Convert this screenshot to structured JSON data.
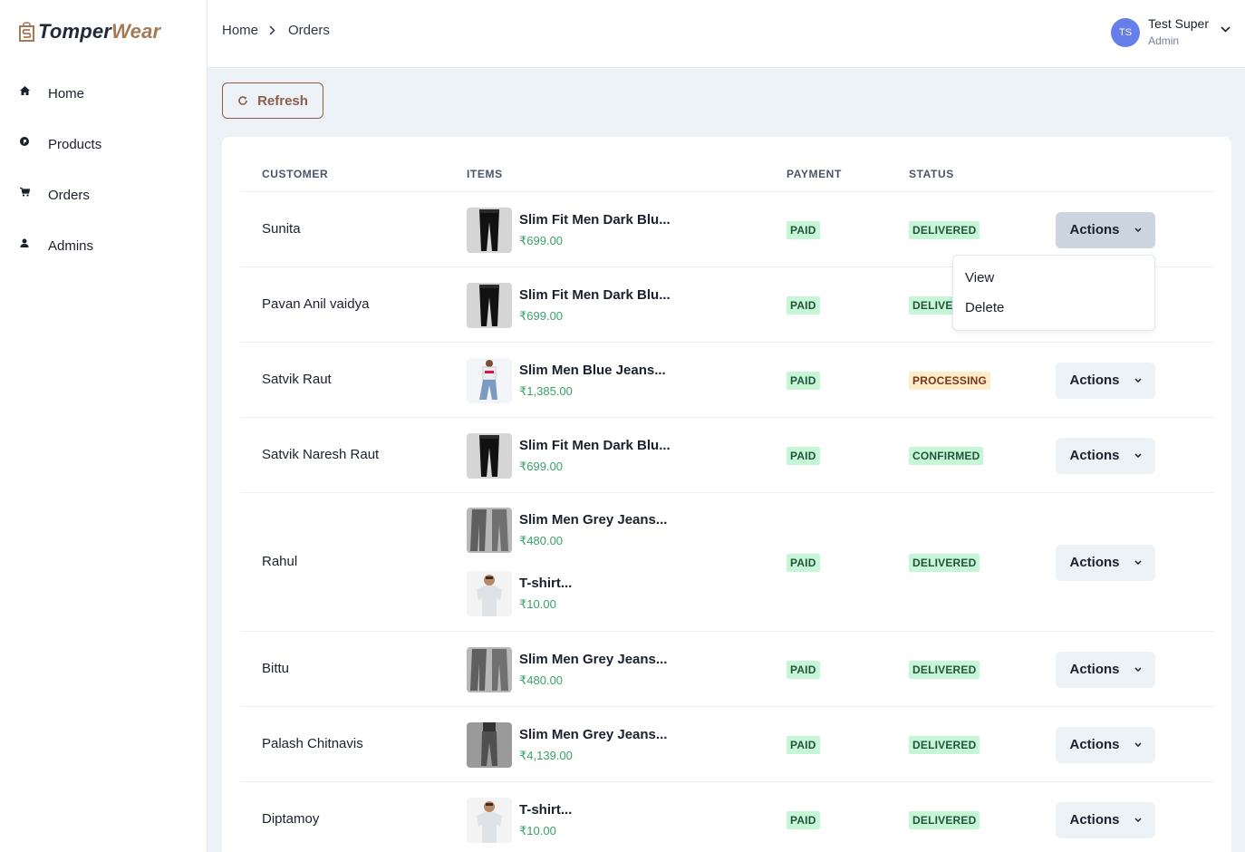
{
  "brand": {
    "part1": "Tomper",
    "part2": "Wear"
  },
  "sidebar": {
    "items": [
      {
        "label": "Home",
        "icon": "home-icon"
      },
      {
        "label": "Products",
        "icon": "product-icon"
      },
      {
        "label": "Orders",
        "icon": "cart-icon"
      },
      {
        "label": "Admins",
        "icon": "user-icon"
      }
    ]
  },
  "breadcrumb": {
    "home": "Home",
    "current": "Orders"
  },
  "user": {
    "initials": "TS",
    "name": "Test Super",
    "role": "Admin"
  },
  "toolbar": {
    "refresh_label": "Refresh"
  },
  "table": {
    "columns": {
      "customer": "CUSTOMER",
      "items": "ITEMS",
      "payment": "PAYMENT",
      "status": "STATUS"
    },
    "actions_label": "Actions",
    "rows": [
      {
        "customer": "Sunita",
        "items": [
          {
            "name": "Slim Fit Men Dark Blu...",
            "price": "₹699.00",
            "thumb": "dark-jeans"
          }
        ],
        "payment": "PAID",
        "status": "DELIVERED"
      },
      {
        "customer": "Pavan Anil vaidya",
        "items": [
          {
            "name": "Slim Fit Men Dark Blu...",
            "price": "₹699.00",
            "thumb": "dark-jeans"
          }
        ],
        "payment": "PAID",
        "status": "DELIVERED"
      },
      {
        "customer": "Satvik Raut",
        "items": [
          {
            "name": "Slim Men Blue Jeans...",
            "price": "₹1,385.00",
            "thumb": "blue-jeans-model"
          }
        ],
        "payment": "PAID",
        "status": "PROCESSING"
      },
      {
        "customer": "Satvik Naresh Raut",
        "items": [
          {
            "name": "Slim Fit Men Dark Blu...",
            "price": "₹699.00",
            "thumb": "dark-jeans"
          }
        ],
        "payment": "PAID",
        "status": "CONFIRMED"
      },
      {
        "customer": "Rahul",
        "items": [
          {
            "name": "Slim Men Grey Jeans...",
            "price": "₹480.00",
            "thumb": "grey-jeans"
          },
          {
            "name": "T-shirt...",
            "price": "₹10.00",
            "thumb": "tshirt-model"
          }
        ],
        "payment": "PAID",
        "status": "DELIVERED"
      },
      {
        "customer": "Bittu",
        "items": [
          {
            "name": "Slim Men Grey Jeans...",
            "price": "₹480.00",
            "thumb": "grey-jeans"
          }
        ],
        "payment": "PAID",
        "status": "DELIVERED"
      },
      {
        "customer": "Palash Chitnavis",
        "items": [
          {
            "name": "Slim Men Grey Jeans...",
            "price": "₹4,139.00",
            "thumb": "grey-jeans-model"
          }
        ],
        "payment": "PAID",
        "status": "DELIVERED"
      },
      {
        "customer": "Diptamoy",
        "items": [
          {
            "name": "T-shirt...",
            "price": "₹10.00",
            "thumb": "tshirt-model"
          }
        ],
        "payment": "PAID",
        "status": "DELIVERED"
      }
    ]
  },
  "dropdown": {
    "view": "View",
    "delete": "Delete"
  },
  "colors": {
    "brand": "#a47a55",
    "accent": "#8b5e4a",
    "paid_bg": "#c6f6d5",
    "processing_bg": "#feebc8",
    "price": "#38a169",
    "avatar": "#667eea"
  }
}
